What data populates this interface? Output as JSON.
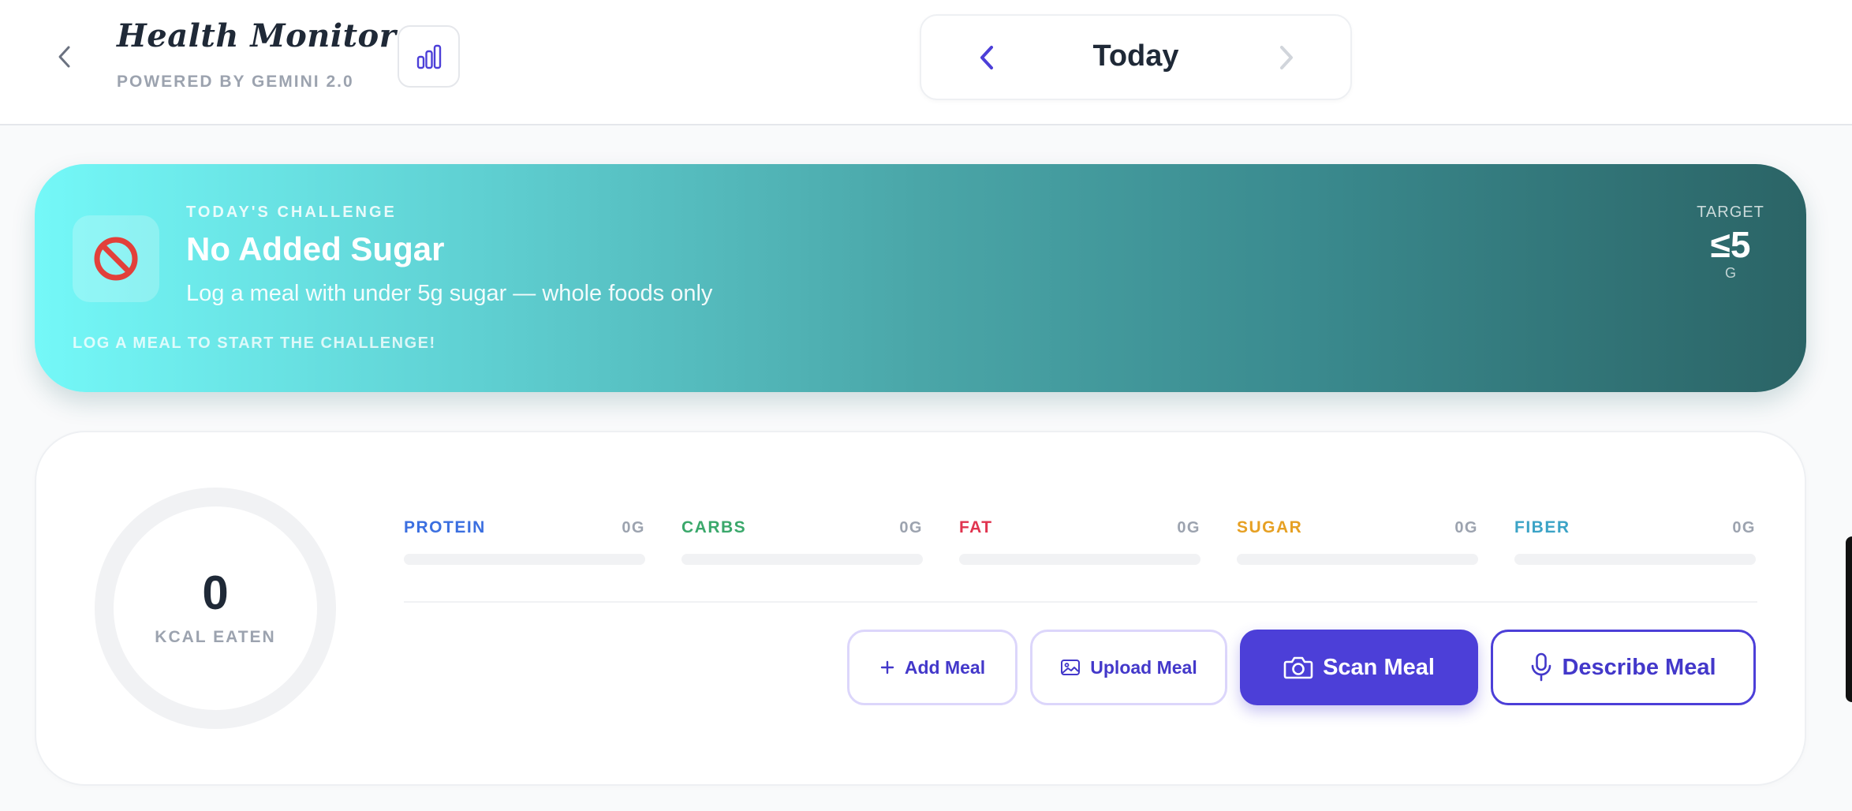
{
  "header": {
    "app_title": "Health Monitor",
    "app_subtitle": "POWERED BY GEMINI 2.0",
    "day_label": "Today"
  },
  "challenge": {
    "eyebrow": "TODAY'S CHALLENGE",
    "title": "No Added Sugar",
    "description": "Log a meal with under 5g sugar — whole foods only",
    "footer": "LOG A MEAL TO START THE CHALLENGE!",
    "target_label": "TARGET",
    "target_value": "≤5",
    "target_unit": "G",
    "icon": "no-entry-icon"
  },
  "summary": {
    "kcal_value": "0",
    "kcal_label": "KCAL EATEN",
    "macros": [
      {
        "name": "PROTEIN",
        "value": "0G",
        "color": "#3b6fe0",
        "progress": 0
      },
      {
        "name": "CARBS",
        "value": "0G",
        "color": "#3aa86b",
        "progress": 0
      },
      {
        "name": "FAT",
        "value": "0G",
        "color": "#e0344f",
        "progress": 0
      },
      {
        "name": "SUGAR",
        "value": "0G",
        "color": "#e6a023",
        "progress": 0
      },
      {
        "name": "FIBER",
        "value": "0G",
        "color": "#3ba3c6",
        "progress": 0
      }
    ]
  },
  "actions": {
    "add_meal": "Add Meal",
    "upload_meal": "Upload Meal",
    "scan_meal": "Scan Meal",
    "describe_meal": "Describe Meal"
  },
  "colors": {
    "accent": "#4c3fd8",
    "accent_text": "#4338ca",
    "challenge_gradient_start": "#74f8f8",
    "challenge_gradient_end": "#2b6466"
  }
}
